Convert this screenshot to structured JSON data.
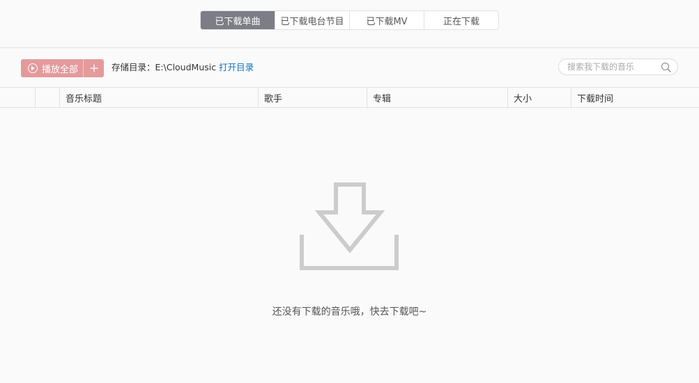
{
  "tabs": [
    {
      "label": "已下载单曲",
      "active": true
    },
    {
      "label": "已下载电台节目",
      "active": false
    },
    {
      "label": "已下载MV",
      "active": false
    },
    {
      "label": "正在下载",
      "active": false
    }
  ],
  "toolbar": {
    "play_all_label": "播放全部",
    "storage_label": "存储目录：",
    "storage_path": "E:\\CloudMusic",
    "open_dir_label": "打开目录",
    "search_placeholder": "搜索我下载的音乐"
  },
  "table": {
    "columns": [
      "音乐标题",
      "歌手",
      "专辑",
      "大小",
      "下载时间"
    ]
  },
  "empty": {
    "message": "还没有下载的音乐哦，快去下载吧~"
  },
  "colors": {
    "accent_play": "#e49a9b",
    "active_tab": "#7c7d85",
    "link": "#0c73c2",
    "empty_icon": "#cccccc"
  }
}
